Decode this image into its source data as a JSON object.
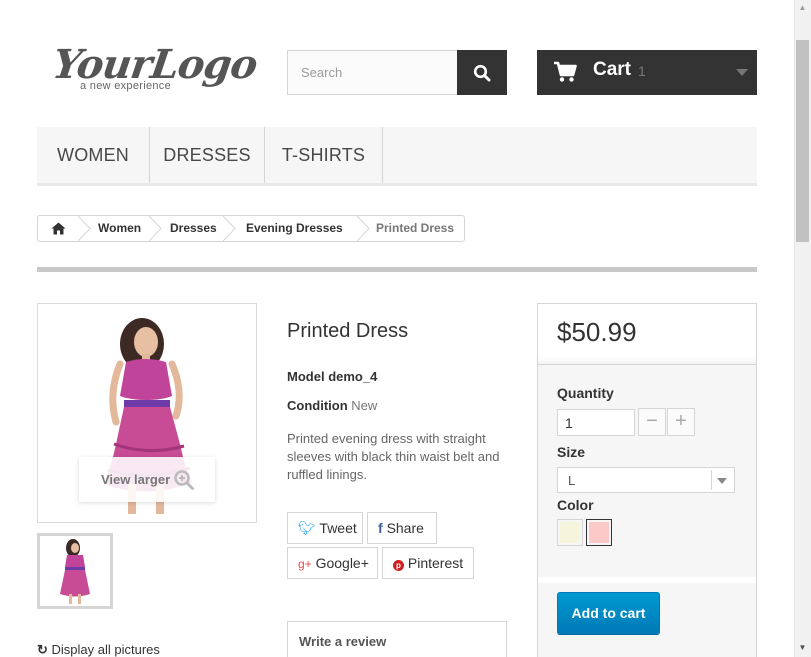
{
  "logo": {
    "main": "YourLogo",
    "tagline": "a new experience"
  },
  "search": {
    "placeholder": "Search"
  },
  "cart": {
    "label": "Cart",
    "count": "1"
  },
  "menu": {
    "items": [
      {
        "label": "WOMEN"
      },
      {
        "label": "DRESSES"
      },
      {
        "label": "T-SHIRTS"
      }
    ]
  },
  "breadcrumb": {
    "items": [
      "Women",
      "Dresses",
      "Evening Dresses"
    ],
    "current": "Printed Dress"
  },
  "product": {
    "view_larger": "View larger",
    "display_all": "Display all pictures",
    "title": "Printed Dress",
    "model_label": "Model",
    "model_value": "demo_4",
    "condition_label": "Condition",
    "condition_value": "New",
    "description": "Printed evening dress with straight sleeves with black thin waist belt and ruffled linings."
  },
  "social": {
    "tweet": "Tweet",
    "share": "Share",
    "google": "Google+",
    "pinterest": "Pinterest"
  },
  "review": {
    "title": "Write a review"
  },
  "buy": {
    "price": "$50.99",
    "quantity_label": "Quantity",
    "quantity_value": "1",
    "minus": "−",
    "plus": "+",
    "size_label": "Size",
    "size_value": "L",
    "color_label": "Color",
    "colors": [
      "#f5f5dc",
      "#fcc8c8"
    ],
    "add_to_cart": "Add to cart"
  }
}
